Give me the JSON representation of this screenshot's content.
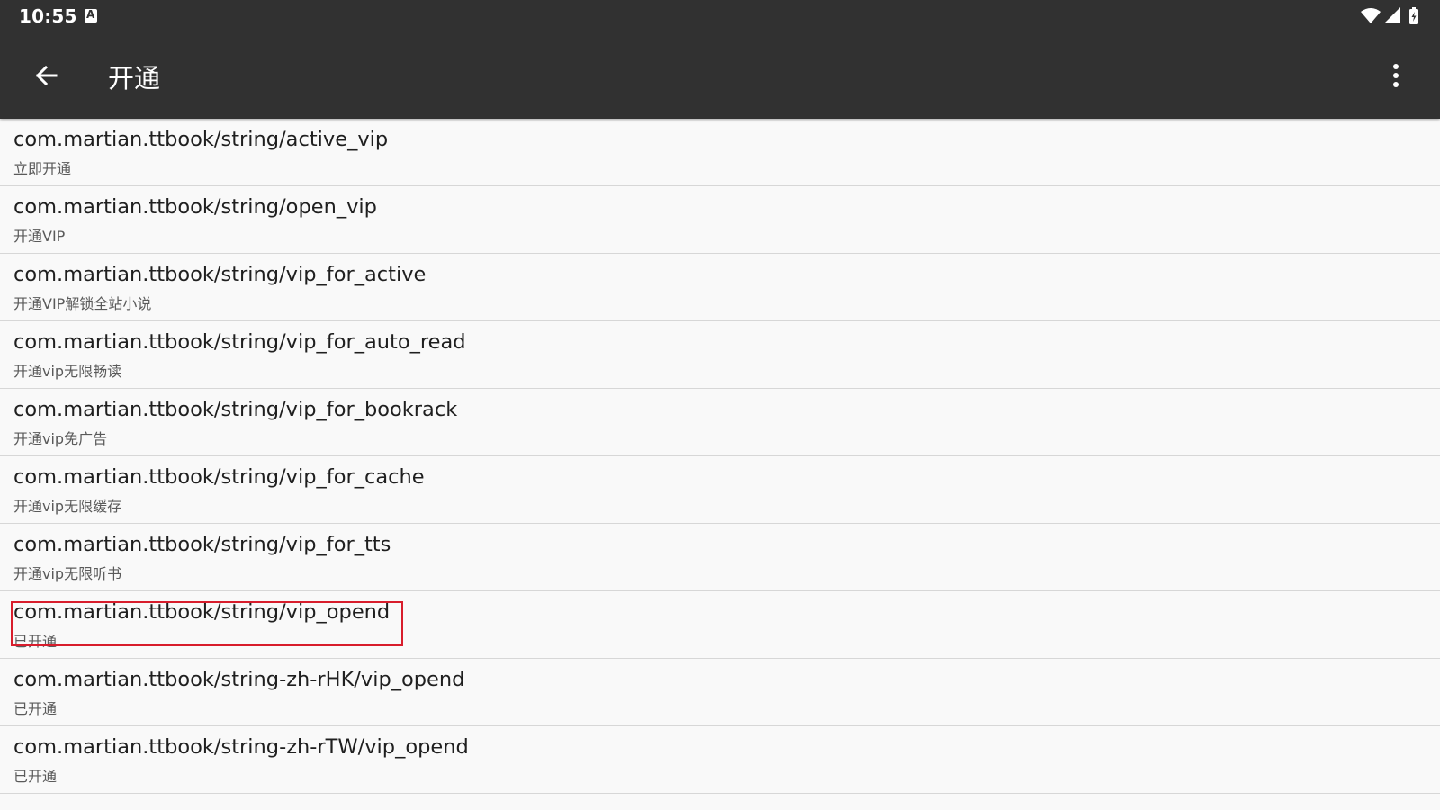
{
  "status_bar": {
    "time": "10:55",
    "notification_icon": "a-keyboard-icon",
    "icons": [
      "wifi-icon",
      "signal-icon",
      "battery-charging-icon"
    ]
  },
  "app_bar": {
    "title": "开通",
    "back_icon": "arrow-back-icon",
    "menu_icon": "more-vert-icon",
    "background_color": "#313131"
  },
  "list": {
    "items": [
      {
        "title": "com.martian.ttbook/string/active_vip",
        "value": "立即开通",
        "highlighted": false
      },
      {
        "title": "com.martian.ttbook/string/open_vip",
        "value": "开通VIP",
        "highlighted": false
      },
      {
        "title": "com.martian.ttbook/string/vip_for_active",
        "value": "开通VIP解锁全站小说",
        "highlighted": false
      },
      {
        "title": "com.martian.ttbook/string/vip_for_auto_read",
        "value": "开通vip无限畅读",
        "highlighted": false
      },
      {
        "title": "com.martian.ttbook/string/vip_for_bookrack",
        "value": "开通vip免广告",
        "highlighted": false
      },
      {
        "title": "com.martian.ttbook/string/vip_for_cache",
        "value": "开通vip无限缓存",
        "highlighted": false
      },
      {
        "title": "com.martian.ttbook/string/vip_for_tts",
        "value": "开通vip无限听书",
        "highlighted": false
      },
      {
        "title": "com.martian.ttbook/string/vip_opend",
        "value": "已开通",
        "highlighted": true
      },
      {
        "title": "com.martian.ttbook/string-zh-rHK/vip_opend",
        "value": "已开通",
        "highlighted": false
      },
      {
        "title": "com.martian.ttbook/string-zh-rTW/vip_opend",
        "value": "已开通",
        "highlighted": false
      }
    ],
    "highlight_color": "#d81d2c"
  }
}
